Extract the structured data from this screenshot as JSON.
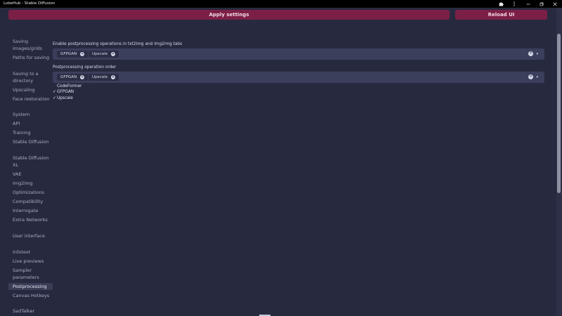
{
  "window": {
    "title": "LobeHub - Stable Diffusion",
    "controls": [
      "puzzle-icon",
      "more-vertical-icon",
      "minimize-icon",
      "restore-icon",
      "close-icon"
    ]
  },
  "toolbar": {
    "apply_label": "Apply settings",
    "reload_label": "Reload UI"
  },
  "sidebar": {
    "items": [
      {
        "label": "Saving images/grids"
      },
      {
        "label": "Paths for saving"
      },
      {
        "label": "Saving to a directory"
      },
      {
        "label": "Upscaling"
      },
      {
        "label": "Face restoration"
      },
      {
        "label": "System"
      },
      {
        "label": "API"
      },
      {
        "label": "Training"
      },
      {
        "label": "Stable Diffusion"
      },
      {
        "label": "Stable Diffusion XL"
      },
      {
        "label": "VAE"
      },
      {
        "label": "img2img"
      },
      {
        "label": "Optimizations"
      },
      {
        "label": "Compatibility"
      },
      {
        "label": "Interrogate"
      },
      {
        "label": "Extra Networks"
      },
      {
        "label": "User interface"
      },
      {
        "label": "Infotext"
      },
      {
        "label": "Live previews"
      },
      {
        "label": "Sampler parameters"
      },
      {
        "label": "Postprocessing"
      },
      {
        "label": "Canvas Hotkeys"
      },
      {
        "label": "SadTalker"
      }
    ],
    "active": "Postprocessing"
  },
  "main": {
    "enable_label": "Enable postprocessing operations in txt2img and img2img tabs",
    "enable_chips": [
      "GFPGAN",
      "Upscale"
    ],
    "order_label": "Postprocessing operation order",
    "order_chips": [
      "GFPGAN",
      "Upscale"
    ],
    "dropdown_options": [
      {
        "label": "CodeFormer",
        "checked": false
      },
      {
        "label": "GFPGAN",
        "checked": true
      },
      {
        "label": "Upscale",
        "checked": true
      }
    ],
    "check_glyph": "✓",
    "remove_glyph": "✕",
    "caret_glyph": "▾"
  },
  "colors": {
    "background": "#272a3f",
    "accent": "#7c1f47",
    "input_bg": "#3b3f5c"
  }
}
